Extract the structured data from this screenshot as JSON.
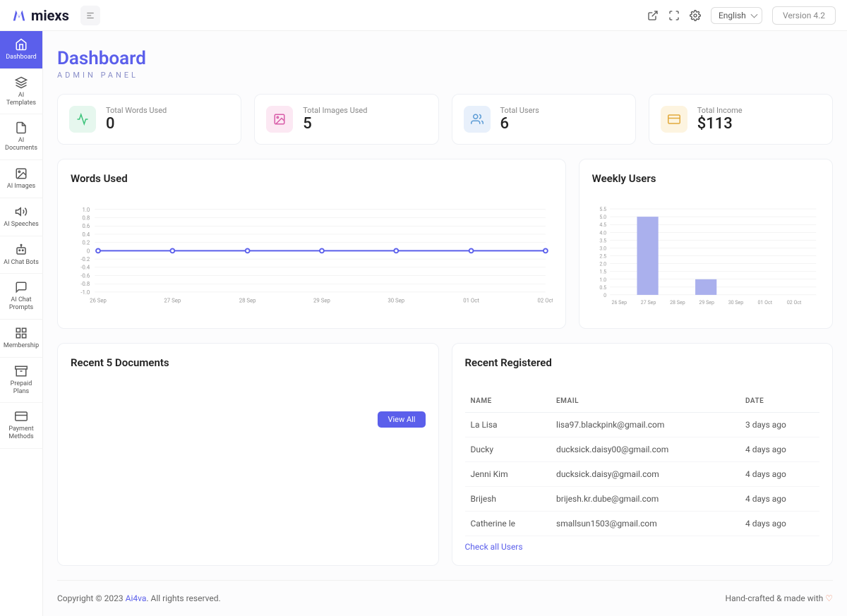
{
  "brand": "miexs",
  "topbar": {
    "lang": "English",
    "version": "Version 4.2"
  },
  "sidebar": {
    "items": [
      {
        "label": "Dashboard"
      },
      {
        "label": "AI Templates"
      },
      {
        "label": "AI Documents"
      },
      {
        "label": "AI Images"
      },
      {
        "label": "AI Speeches"
      },
      {
        "label": "AI Chat Bots"
      },
      {
        "label": "AI Chat Prompts"
      },
      {
        "label": "Membership"
      },
      {
        "label": "Prepaid Plans"
      },
      {
        "label": "Payment Methods"
      }
    ]
  },
  "page": {
    "title": "Dashboard",
    "subtitle": "ADMIN PANEL"
  },
  "stats": [
    {
      "label": "Total Words Used",
      "value": "0"
    },
    {
      "label": "Total Images Used",
      "value": "5"
    },
    {
      "label": "Total Users",
      "value": "6"
    },
    {
      "label": "Total Income",
      "value": "$113"
    }
  ],
  "charts": {
    "words": {
      "title": "Words Used"
    },
    "weekly": {
      "title": "Weekly Users"
    }
  },
  "recent_docs": {
    "title": "Recent 5 Documents",
    "view_all": "View All"
  },
  "recent_users": {
    "title": "Recent Registered",
    "headers": {
      "name": "NAME",
      "email": "EMAIL",
      "date": "DATE"
    },
    "rows": [
      {
        "name": "La Lisa",
        "email": "lisa97.blackpink@gmail.com",
        "date": "3 days ago"
      },
      {
        "name": "Ducky",
        "email": "ducksick.daisy00@gmail.com",
        "date": "4 days ago"
      },
      {
        "name": "Jenni Kim",
        "email": "ducksick.daisy@gmail.com",
        "date": "4 days ago"
      },
      {
        "name": "Brijesh",
        "email": "brijesh.kr.dube@gmail.com",
        "date": "4 days ago"
      },
      {
        "name": "Catherine le",
        "email": "smallsun1503@gmail.com",
        "date": "4 days ago"
      }
    ],
    "check_all": "Check all Users"
  },
  "footer": {
    "copyright_prefix": "Copyright © 2023 ",
    "link": "Ai4va",
    "copyright_suffix": ". All rights reserved.",
    "credit": "Hand-crafted & made with"
  },
  "chart_data": [
    {
      "type": "line",
      "title": "Words Used",
      "categories": [
        "26 Sep",
        "27 Sep",
        "28 Sep",
        "29 Sep",
        "30 Sep",
        "01 Oct",
        "02 Oct"
      ],
      "values": [
        0,
        0,
        0,
        0,
        0,
        0,
        0
      ],
      "ylabel": "",
      "ylim": [
        -1.0,
        1.0
      ],
      "yticks": [
        -1.0,
        -0.8,
        -0.6,
        -0.4,
        -0.2,
        0,
        0.2,
        0.4,
        0.6,
        0.8,
        1.0
      ]
    },
    {
      "type": "bar",
      "title": "Weekly Users",
      "categories": [
        "26 Sep",
        "27 Sep",
        "28 Sep",
        "29 Sep",
        "30 Sep",
        "01 Oct",
        "02 Oct"
      ],
      "values": [
        0,
        5,
        0,
        1,
        0,
        0,
        0,
        0
      ],
      "ylabel": "",
      "ylim": [
        0,
        5.5
      ],
      "yticks": [
        0,
        0.5,
        1.0,
        1.5,
        2.0,
        2.5,
        3.0,
        3.5,
        4.0,
        4.5,
        5.0,
        5.5
      ]
    }
  ]
}
